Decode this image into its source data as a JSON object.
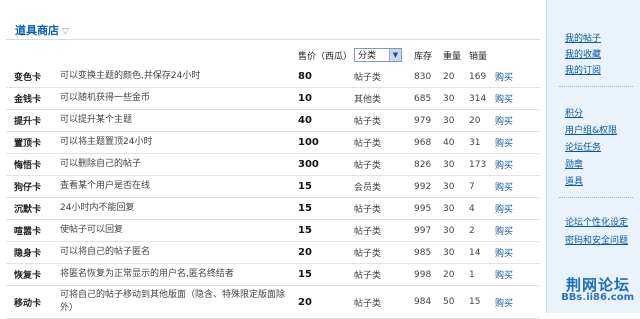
{
  "shop": {
    "title": "道具商店",
    "collapse_icon": "chevron-down-icon"
  },
  "table": {
    "headers": {
      "price": "售价（西瓜）",
      "stock": "库存",
      "weight": "重量",
      "sales": "销量"
    },
    "category_select": {
      "value": "分类"
    },
    "rows": [
      {
        "name": "变色卡",
        "desc": "可以变换主题的颜色,并保存24小时",
        "price": "80",
        "category": "帖子类",
        "stock": "830",
        "weight": "20",
        "sales": "169",
        "buy": "购买"
      },
      {
        "name": "金钱卡",
        "desc": "可以随机获得一些金币",
        "price": "10",
        "category": "其他类",
        "stock": "685",
        "weight": "30",
        "sales": "314",
        "buy": "购买"
      },
      {
        "name": "提升卡",
        "desc": "可以提升某个主题",
        "price": "40",
        "category": "帖子类",
        "stock": "979",
        "weight": "30",
        "sales": "20",
        "buy": "购买"
      },
      {
        "name": "置顶卡",
        "desc": "可以将主题置顶24小时",
        "price": "100",
        "category": "帖子类",
        "stock": "968",
        "weight": "40",
        "sales": "31",
        "buy": "购买"
      },
      {
        "name": "悔悟卡",
        "desc": "可以删除自己的帖子",
        "price": "300",
        "category": "帖子类",
        "stock": "826",
        "weight": "30",
        "sales": "173",
        "buy": "购买"
      },
      {
        "name": "狗仔卡",
        "desc": "查看某个用户是否在线",
        "price": "15",
        "category": "会员类",
        "stock": "992",
        "weight": "30",
        "sales": "7",
        "buy": "购买"
      },
      {
        "name": "沉默卡",
        "desc": "24小时内不能回复",
        "price": "15",
        "category": "帖子类",
        "stock": "995",
        "weight": "30",
        "sales": "4",
        "buy": "购买"
      },
      {
        "name": "喧嚣卡",
        "desc": "使帖子可以回复",
        "price": "15",
        "category": "帖子类",
        "stock": "997",
        "weight": "30",
        "sales": "2",
        "buy": "购买"
      },
      {
        "name": "隐身卡",
        "desc": "可以将自己的帖子匿名",
        "price": "20",
        "category": "帖子类",
        "stock": "985",
        "weight": "30",
        "sales": "14",
        "buy": "购买"
      },
      {
        "name": "恢复卡",
        "desc": "将匿名恢复为正常显示的用户名,匿名终结者",
        "price": "15",
        "category": "帖子类",
        "stock": "998",
        "weight": "20",
        "sales": "1",
        "buy": "购买"
      },
      {
        "name": "移动卡",
        "desc": "可将自己的帖子移动到其他版面（隐含、特殊限定版面除外）",
        "price": "20",
        "category": "帖子类",
        "stock": "984",
        "weight": "50",
        "sales": "15",
        "buy": "购买"
      }
    ]
  },
  "sidebar": {
    "group1": [
      "我的帖子",
      "我的收藏",
      "我的订阅"
    ],
    "group2": [
      "积分",
      "用户组&权限",
      "论坛任务",
      "勋章",
      "道具"
    ],
    "group3": [
      "论坛个性化设定",
      "密码和安全问题"
    ]
  },
  "watermark": {
    "title": "荆网论坛",
    "url_prefix": "BBs",
    "url_dot": ".",
    "url_suffix": "ii86.com"
  }
}
